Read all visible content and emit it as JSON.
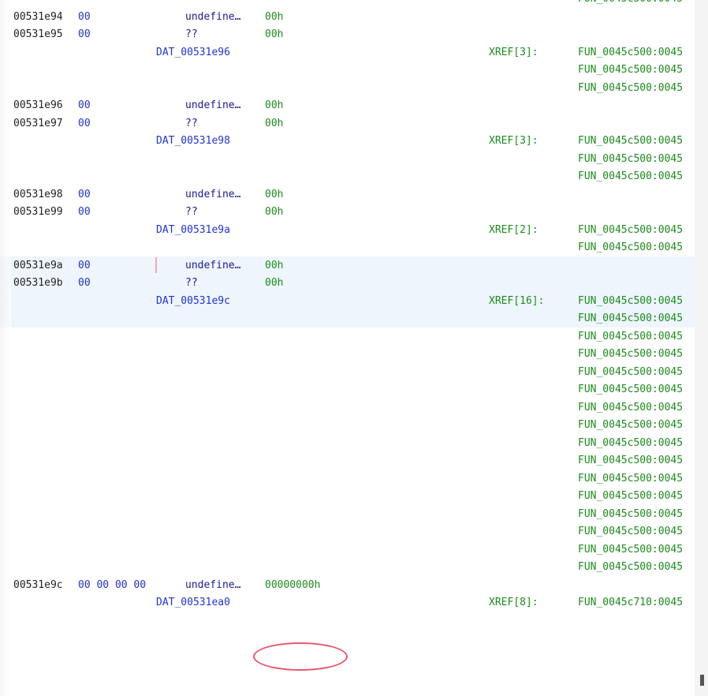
{
  "listing": {
    "rows": [
      {
        "kind": "cut",
        "xref": "FUN_0045c500:0045"
      },
      {
        "kind": "code",
        "addr": "00531e94",
        "bytes": "00",
        "mnem": "undefine…",
        "operand": "00h"
      },
      {
        "kind": "code",
        "addr": "00531e95",
        "bytes": "00",
        "mnem": "??",
        "operand": "00h"
      },
      {
        "kind": "label",
        "label": "DAT_00531e96",
        "xref_label": "XREF[3]:",
        "xref": "FUN_0045c500:0045"
      },
      {
        "kind": "xref",
        "xref": "FUN_0045c500:0045"
      },
      {
        "kind": "xref",
        "xref": "FUN_0045c500:0045"
      },
      {
        "kind": "code",
        "addr": "00531e96",
        "bytes": "00",
        "mnem": "undefine…",
        "operand": "00h"
      },
      {
        "kind": "code",
        "addr": "00531e97",
        "bytes": "00",
        "mnem": "??",
        "operand": "00h"
      },
      {
        "kind": "label",
        "label": "DAT_00531e98",
        "xref_label": "XREF[3]:",
        "xref": "FUN_0045c500:0045"
      },
      {
        "kind": "xref",
        "xref": "FUN_0045c500:0045"
      },
      {
        "kind": "xref",
        "xref": "FUN_0045c500:0045"
      },
      {
        "kind": "code",
        "addr": "00531e98",
        "bytes": "00",
        "mnem": "undefine…",
        "operand": "00h"
      },
      {
        "kind": "code",
        "addr": "00531e99",
        "bytes": "00",
        "mnem": "??",
        "operand": "00h"
      },
      {
        "kind": "label",
        "label": "DAT_00531e9a",
        "xref_label": "XREF[2]:",
        "xref": "FUN_0045c500:0045"
      },
      {
        "kind": "xref",
        "xref": "FUN_0045c500:0045"
      },
      {
        "kind": "code",
        "addr": "00531e9a",
        "bytes": "00",
        "mnem": "undefine…",
        "operand": "00h"
      },
      {
        "kind": "code",
        "addr": "00531e9b",
        "bytes": "00",
        "mnem": "??",
        "operand": "00h"
      },
      {
        "kind": "label",
        "label": "DAT_00531e9c",
        "xref_label": "XREF[16]:",
        "xref": "FUN_0045c500:0045"
      },
      {
        "kind": "xref",
        "xref": "FUN_0045c500:0045"
      },
      {
        "kind": "xref",
        "xref": "FUN_0045c500:0045"
      },
      {
        "kind": "xref",
        "xref": "FUN_0045c500:0045"
      },
      {
        "kind": "xref",
        "xref": "FUN_0045c500:0045"
      },
      {
        "kind": "xref",
        "xref": "FUN_0045c500:0045"
      },
      {
        "kind": "xref",
        "xref": "FUN_0045c500:0045"
      },
      {
        "kind": "xref",
        "xref": "FUN_0045c500:0045"
      },
      {
        "kind": "xref",
        "xref": "FUN_0045c500:0045"
      },
      {
        "kind": "xref",
        "xref": "FUN_0045c500:0045"
      },
      {
        "kind": "xref",
        "xref": "FUN_0045c500:0045"
      },
      {
        "kind": "xref",
        "xref": "FUN_0045c500:0045"
      },
      {
        "kind": "xref",
        "xref": "FUN_0045c500:0045"
      },
      {
        "kind": "xref",
        "xref": "FUN_0045c500:0045"
      },
      {
        "kind": "xref",
        "xref": "FUN_0045c500:0045"
      },
      {
        "kind": "xref",
        "xref": "FUN_0045c500:0045"
      },
      {
        "kind": "code",
        "addr": "00531e9c",
        "bytes": "00 00 00 00",
        "mnem": "undefine…",
        "operand": "00000000h"
      },
      {
        "kind": "label",
        "label": "DAT_00531ea0",
        "xref_label": "XREF[8]:",
        "xref": "FUN_0045c710:0045"
      }
    ]
  },
  "colors": {
    "address": "#222222",
    "bytes": "#2233cc",
    "mnemonic": "#1a1a8c",
    "operand": "#1e8a1e",
    "label": "#2233cc",
    "xref": "#1e8a1e",
    "highlight": "#eef5fd",
    "annotation": "#e8566a"
  }
}
